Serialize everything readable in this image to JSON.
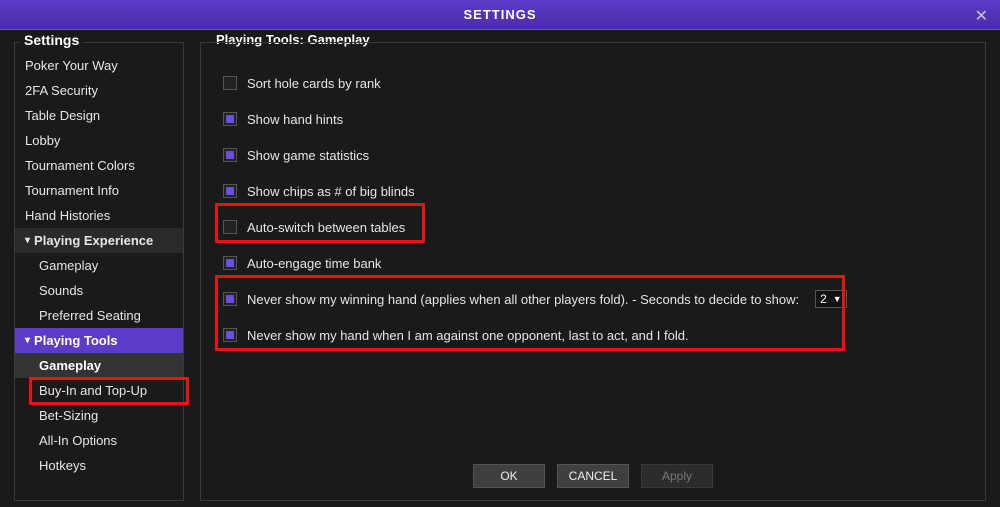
{
  "window": {
    "title": "SETTINGS"
  },
  "sidebar": {
    "legend": "Settings",
    "items": [
      {
        "label": "Poker Your Way",
        "kind": "item"
      },
      {
        "label": "2FA Security",
        "kind": "item"
      },
      {
        "label": "Table Design",
        "kind": "item"
      },
      {
        "label": "Lobby",
        "kind": "item"
      },
      {
        "label": "Tournament Colors",
        "kind": "item"
      },
      {
        "label": "Tournament Info",
        "kind": "item"
      },
      {
        "label": "Hand Histories",
        "kind": "item"
      },
      {
        "label": "Playing Experience",
        "kind": "header"
      },
      {
        "label": "Gameplay",
        "kind": "sub"
      },
      {
        "label": "Sounds",
        "kind": "sub"
      },
      {
        "label": "Preferred Seating",
        "kind": "sub"
      },
      {
        "label": "Playing Tools",
        "kind": "header_selected"
      },
      {
        "label": "Gameplay",
        "kind": "sub_selected"
      },
      {
        "label": "Buy-In and Top-Up",
        "kind": "sub"
      },
      {
        "label": "Bet-Sizing",
        "kind": "sub"
      },
      {
        "label": "All-In Options",
        "kind": "sub"
      },
      {
        "label": "Hotkeys",
        "kind": "sub"
      }
    ]
  },
  "panel": {
    "legend": "Playing Tools: Gameplay",
    "options": [
      {
        "label": "Sort hole cards by rank",
        "checked": false
      },
      {
        "label": "Show hand hints",
        "checked": true
      },
      {
        "label": "Show game statistics",
        "checked": true
      },
      {
        "label": "Show chips as # of big blinds",
        "checked": true
      },
      {
        "label": "Auto-switch between tables",
        "checked": false
      },
      {
        "label": "Auto-engage time bank",
        "checked": true
      },
      {
        "label": "Never show my winning hand (applies when all other players fold). - Seconds to decide to show:",
        "checked": true,
        "select": "2"
      },
      {
        "label": "Never show my hand when I am against one opponent, last to act, and I fold.",
        "checked": true
      }
    ],
    "buttons": {
      "ok": "OK",
      "cancel": "CANCEL",
      "apply": "Apply"
    }
  }
}
